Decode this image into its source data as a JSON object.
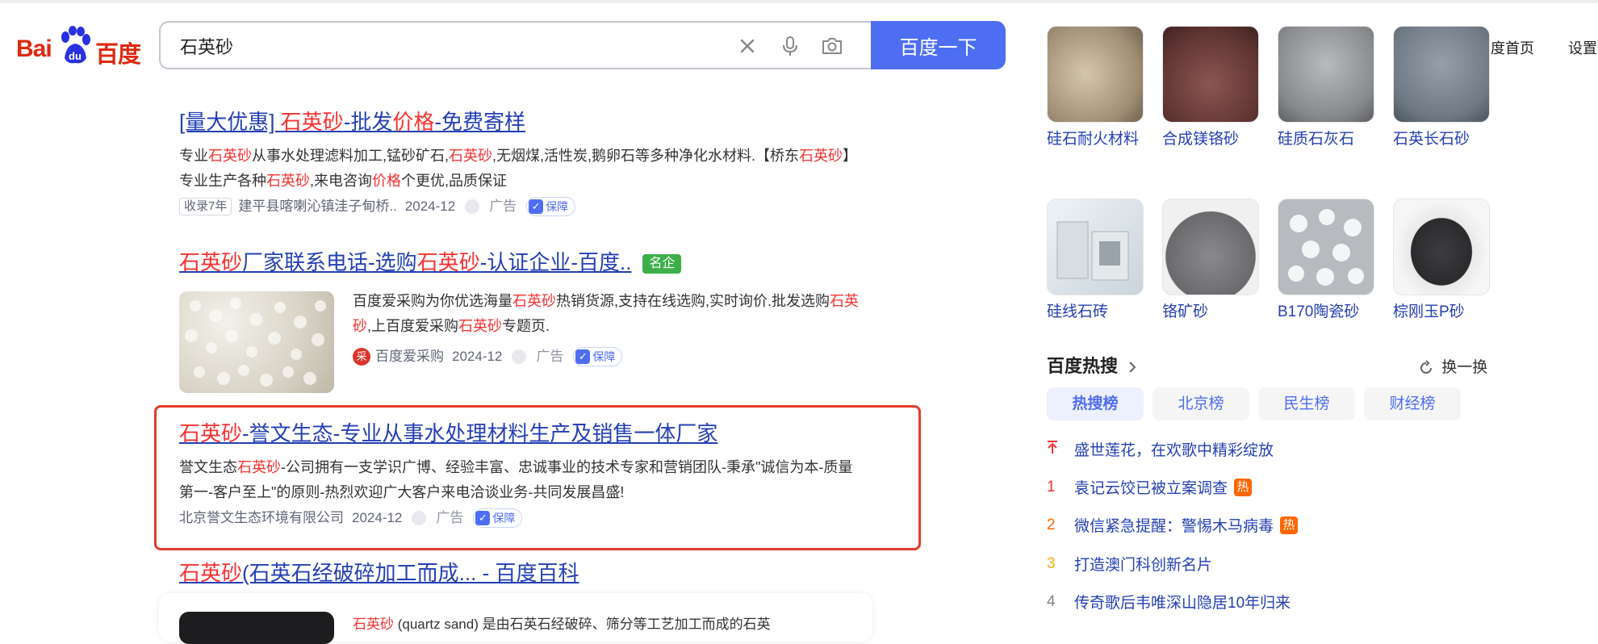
{
  "header": {
    "logo_left": "Bai",
    "logo_right": "百度",
    "logo_paw_text": "du",
    "search_value": "石英砂",
    "search_button": "百度一下",
    "links": [
      "百度首页",
      "设置"
    ]
  },
  "results": [
    {
      "title_parts": [
        "[量大优惠] ",
        "石英砂",
        "-批发",
        "价格",
        "-免费寄样"
      ],
      "desc_parts": [
        "专业",
        "石英砂",
        "从事水处理滤料加工,锰砂矿石,",
        "石英砂",
        ",无烟煤,活性炭,鹅卵石等多种净化水材料.【桥东",
        "石英砂",
        "】专业生产各种",
        "石英砂",
        ",来电咨询",
        "价格",
        "个更优,品质保证"
      ],
      "tag": "收录7年",
      "source": "建平县喀喇沁镇洼子甸桥..",
      "date": "2024-12",
      "ad": "广告",
      "guarantee": "保障"
    },
    {
      "title_parts": [
        "石英砂",
        "厂家联系电话-选购",
        "石英砂",
        "-认证企业-百度.."
      ],
      "badge": "名企",
      "desc_parts": [
        "百度爱采购为你优选海量",
        "石英砂",
        "热销货源,支持在线选购,实时询价.批发选购",
        "石英砂",
        ",上百度爱采购",
        "石英砂",
        "专题页."
      ],
      "source_icon": "采",
      "source": "百度爱采购",
      "date": "2024-12",
      "ad": "广告",
      "guarantee": "保障"
    },
    {
      "title_parts": [
        "石英砂",
        "-誉文生态-专业从事水处理材料生产及销售一体厂家"
      ],
      "desc_parts": [
        "誉文生态",
        "石英砂",
        "-公司拥有一支学识广博、经验丰富、忠诚事业的技术专家和营销团队-秉承\"诚信为本-质量第一-客户至上\"的原则-热烈欢迎广大客户来电洽谈业务-共同发展昌盛!"
      ],
      "source": "北京誉文生态环境有限公司",
      "date": "2024-12",
      "ad": "广告",
      "guarantee": "保障"
    },
    {
      "title_parts": [
        "石英砂",
        "(石英石经破碎加工而成... - 百度百科"
      ],
      "desc_parts": [
        "石英砂",
        " (quartz sand) 是由石英石经破碎、筛分等工艺加工而成的石英"
      ]
    }
  ],
  "side_grid": [
    {
      "label": "硅石耐火材料",
      "color": "#b9a890"
    },
    {
      "label": "合成镁铬砂",
      "color": "#7a4a46"
    },
    {
      "label": "硅质石灰石",
      "color": "#8d8f92"
    },
    {
      "label": "石英长石砂",
      "color": "#77808a"
    },
    {
      "label": "硅线石砖",
      "color": "#dfe6ea"
    },
    {
      "label": "铬矿砂",
      "color": "#6f6f72"
    },
    {
      "label": "B170陶瓷砂",
      "color": "#c9ccd0"
    },
    {
      "label": "棕刚玉P砂",
      "color": "#3d3c3e"
    }
  ],
  "hot": {
    "title": "百度热搜",
    "refresh": "换一换",
    "tabs": [
      "热搜榜",
      "北京榜",
      "民生榜",
      "财经榜"
    ],
    "items": [
      {
        "rank": "↑",
        "text": "盛世莲花，在欢歌中精彩绽放",
        "badge": "",
        "rank_color": "#f73131"
      },
      {
        "rank": "1",
        "text": "袁记云饺已被立案调查",
        "badge": "热",
        "rank_color": "#f73131"
      },
      {
        "rank": "2",
        "text": "微信紧急提醒：警惕木马病毒",
        "badge": "热",
        "rank_color": "#ff6600"
      },
      {
        "rank": "3",
        "text": "打造澳门科创新名片",
        "badge": "",
        "rank_color": "#faa90e"
      },
      {
        "rank": "4",
        "text": "传奇歌后韦唯深山隐居10年归来",
        "badge": "",
        "rank_color": "#858585"
      }
    ]
  }
}
